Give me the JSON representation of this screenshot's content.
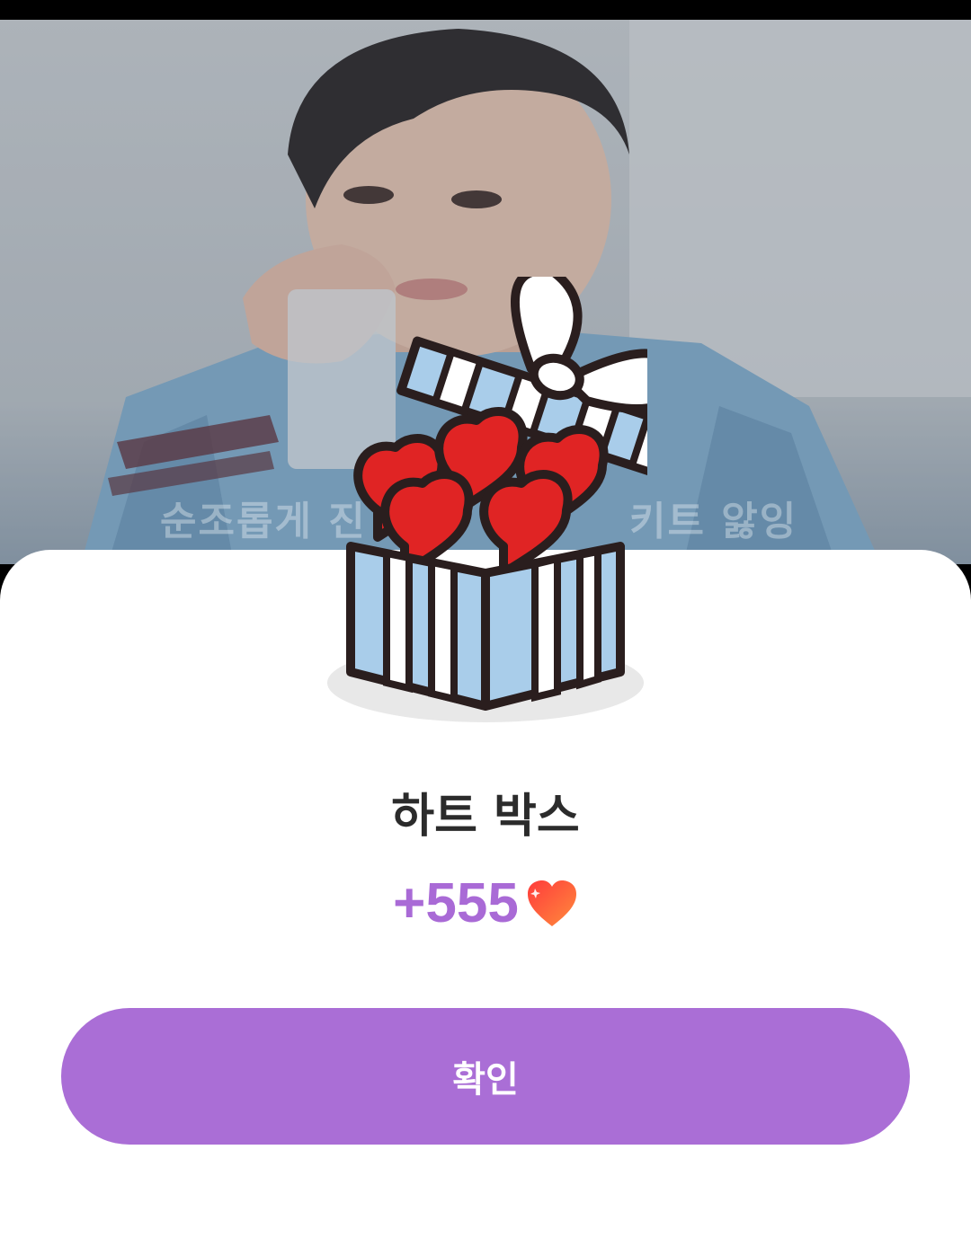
{
  "video": {
    "caption_left": "순조롭게 진",
    "caption_right": "키트 앓잉"
  },
  "reward": {
    "title": "하트 박스",
    "amount": "+555",
    "currency_icon": "heart-icon"
  },
  "actions": {
    "confirm_label": "확인"
  },
  "colors": {
    "accent": "#AA6ED6",
    "amount": "#A96AD6",
    "title": "#2B2B2B",
    "box_blue": "#A9CDEA",
    "heart_red": "#E02424"
  }
}
